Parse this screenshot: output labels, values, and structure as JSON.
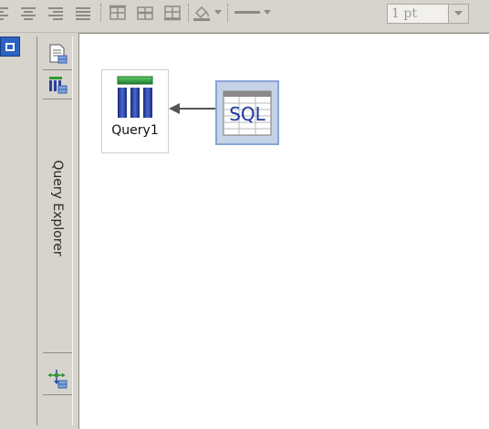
{
  "toolbar": {
    "line_width_value": "1 pt",
    "buttons": [
      "align-left-icon",
      "align-center-icon",
      "align-right-icon",
      "justify-icon",
      "border-top-icon",
      "border-middle-icon",
      "border-bottom-icon",
      "fill-color-icon",
      "line-style-icon"
    ]
  },
  "side_panel": {
    "title": "Query Explorer",
    "icons": [
      "document-icon",
      "table-icon",
      "join-icon"
    ]
  },
  "canvas": {
    "nodes": [
      {
        "label": "Query1",
        "icon": "query-table-icon"
      },
      {
        "label": "SQL",
        "icon": "sql-table-icon"
      }
    ]
  },
  "colors": {
    "chrome": "#d6d4cc",
    "selection_blue": "#86a5d7",
    "query_header_green": "#2e9a36",
    "query_columns_blue": "#2b3f9e"
  }
}
